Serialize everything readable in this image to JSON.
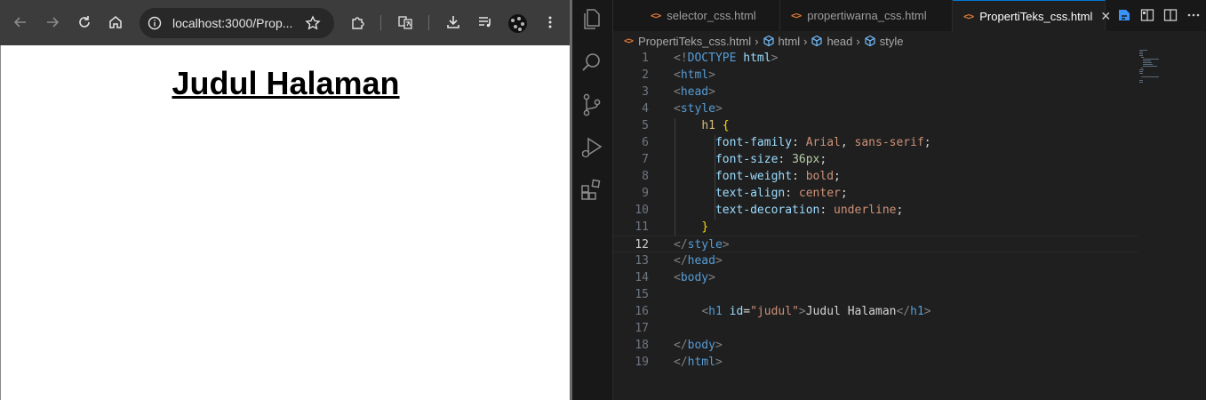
{
  "browser": {
    "url": "localhost:3000/Prop...",
    "page_heading": "Judul Halaman"
  },
  "vscode": {
    "tabs": [
      {
        "label": "selector_css.html",
        "active": false
      },
      {
        "label": "propertiwarna_css.html",
        "active": false
      },
      {
        "label": "PropertiTeks_css.html",
        "active": true
      }
    ],
    "tab_icon": "<>",
    "close_glyph": "✕",
    "breadcrumb": {
      "file": "PropertiTeks_css.html",
      "items": [
        "html",
        "head",
        "style"
      ]
    },
    "current_line": "12",
    "code_lines": [
      {
        "n": "1",
        "tokens": [
          [
            "br",
            "<!"
          ],
          [
            "tag",
            "DOCTYPE"
          ],
          [
            "txt",
            " "
          ],
          [
            "attr",
            "html"
          ],
          [
            "br",
            ">"
          ]
        ]
      },
      {
        "n": "2",
        "tokens": [
          [
            "br",
            "<"
          ],
          [
            "tag",
            "html"
          ],
          [
            "br",
            ">"
          ]
        ]
      },
      {
        "n": "3",
        "tokens": [
          [
            "br",
            "<"
          ],
          [
            "tag",
            "head"
          ],
          [
            "br",
            ">"
          ]
        ]
      },
      {
        "n": "4",
        "tokens": [
          [
            "br",
            "<"
          ],
          [
            "tag",
            "style"
          ],
          [
            "br",
            ">"
          ]
        ]
      },
      {
        "n": "5",
        "tokens": [
          [
            "txt",
            "    "
          ],
          [
            "sel",
            "h1"
          ],
          [
            "txt",
            " "
          ],
          [
            "brace",
            "{"
          ]
        ]
      },
      {
        "n": "6",
        "tokens": [
          [
            "txt",
            "      "
          ],
          [
            "attr",
            "font-family"
          ],
          [
            "punc",
            ": "
          ],
          [
            "val",
            "Arial"
          ],
          [
            "punc",
            ", "
          ],
          [
            "val",
            "sans-serif"
          ],
          [
            "punc",
            ";"
          ]
        ]
      },
      {
        "n": "7",
        "tokens": [
          [
            "txt",
            "      "
          ],
          [
            "attr",
            "font-size"
          ],
          [
            "punc",
            ": "
          ],
          [
            "num",
            "36px"
          ],
          [
            "punc",
            ";"
          ]
        ]
      },
      {
        "n": "8",
        "tokens": [
          [
            "txt",
            "      "
          ],
          [
            "attr",
            "font-weight"
          ],
          [
            "punc",
            ": "
          ],
          [
            "val",
            "bold"
          ],
          [
            "punc",
            ";"
          ]
        ]
      },
      {
        "n": "9",
        "tokens": [
          [
            "txt",
            "      "
          ],
          [
            "attr",
            "text-align"
          ],
          [
            "punc",
            ": "
          ],
          [
            "val",
            "center"
          ],
          [
            "punc",
            ";"
          ]
        ]
      },
      {
        "n": "10",
        "tokens": [
          [
            "txt",
            "      "
          ],
          [
            "attr",
            "text-decoration"
          ],
          [
            "punc",
            ": "
          ],
          [
            "val",
            "underline"
          ],
          [
            "punc",
            ";"
          ]
        ]
      },
      {
        "n": "11",
        "tokens": [
          [
            "txt",
            "    "
          ],
          [
            "brace",
            "}"
          ]
        ]
      },
      {
        "n": "12",
        "tokens": [
          [
            "br",
            "</"
          ],
          [
            "tag",
            "style"
          ],
          [
            "br",
            ">"
          ]
        ]
      },
      {
        "n": "13",
        "tokens": [
          [
            "br",
            "</"
          ],
          [
            "tag",
            "head"
          ],
          [
            "br",
            ">"
          ]
        ]
      },
      {
        "n": "14",
        "tokens": [
          [
            "br",
            "<"
          ],
          [
            "tag",
            "body"
          ],
          [
            "br",
            ">"
          ]
        ]
      },
      {
        "n": "15",
        "tokens": []
      },
      {
        "n": "16",
        "tokens": [
          [
            "txt",
            "    "
          ],
          [
            "br",
            "<"
          ],
          [
            "tag",
            "h1"
          ],
          [
            "txt",
            " "
          ],
          [
            "attr",
            "id"
          ],
          [
            "punc",
            "="
          ],
          [
            "str",
            "\"judul\""
          ],
          [
            "br",
            ">"
          ],
          [
            "txt",
            "Judul Halaman"
          ],
          [
            "br",
            "</"
          ],
          [
            "tag",
            "h1"
          ],
          [
            "br",
            ">"
          ]
        ]
      },
      {
        "n": "17",
        "tokens": []
      },
      {
        "n": "18",
        "tokens": [
          [
            "br",
            "</"
          ],
          [
            "tag",
            "body"
          ],
          [
            "br",
            ">"
          ]
        ]
      },
      {
        "n": "19",
        "tokens": [
          [
            "br",
            "</"
          ],
          [
            "tag",
            "html"
          ],
          [
            "br",
            ">"
          ]
        ]
      }
    ]
  },
  "colors": {
    "accent": "#0078d4",
    "html_file_icon": "#e37933"
  }
}
